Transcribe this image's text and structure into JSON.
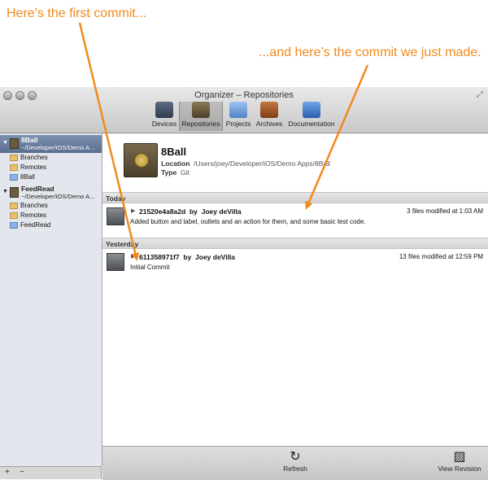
{
  "annotations": {
    "first_commit": "Here’s the first commit...",
    "latest_commit": "...and here’s the commit we just made."
  },
  "window": {
    "title": "Organizer – Repositories",
    "toolbar": [
      {
        "label": "Devices",
        "icon": "devices-icon"
      },
      {
        "label": "Repositories",
        "icon": "repositories-icon",
        "selected": true
      },
      {
        "label": "Projects",
        "icon": "projects-icon"
      },
      {
        "label": "Archives",
        "icon": "archives-icon"
      },
      {
        "label": "Documentation",
        "icon": "documentation-icon"
      }
    ]
  },
  "sidebar": {
    "repos": [
      {
        "name": "8Ball",
        "path": "~/Developer/iOS/Demo A...",
        "selected": true,
        "items": [
          "Branches",
          "Remotes",
          "8Ball"
        ]
      },
      {
        "name": "FeedRead",
        "path": "~/Developer/iOS/Demo A...",
        "selected": false,
        "items": [
          "Branches",
          "Remotes",
          "FeedRead"
        ]
      }
    ],
    "add_label": "+",
    "remove_label": "−"
  },
  "repo": {
    "name": "8Ball",
    "location_label": "Location",
    "location": "/Users/joey/Developer/iOS/Demo Apps/8Ball",
    "type_label": "Type",
    "type": "Git"
  },
  "sections": [
    {
      "title": "Today",
      "commit": {
        "hash": "21520e4a8a2d",
        "by": "by",
        "author": "Joey deVilla",
        "message": "Added button and label, outlets and an action for them, and some basic test code.",
        "files": "3 files modified at 1:03 AM"
      }
    },
    {
      "title": "Yesterday",
      "commit": {
        "hash": "611358971f7",
        "by": "by",
        "author": "Joey deVilla",
        "message": "Initial Commit",
        "files": "13 files modified at 12:59 PM"
      }
    }
  ],
  "bottom": {
    "refresh_label": "Refresh",
    "view_revision_label": "View Revision"
  },
  "colors": {
    "annotation": "#f18a1c",
    "selection": "#5a6e93"
  }
}
